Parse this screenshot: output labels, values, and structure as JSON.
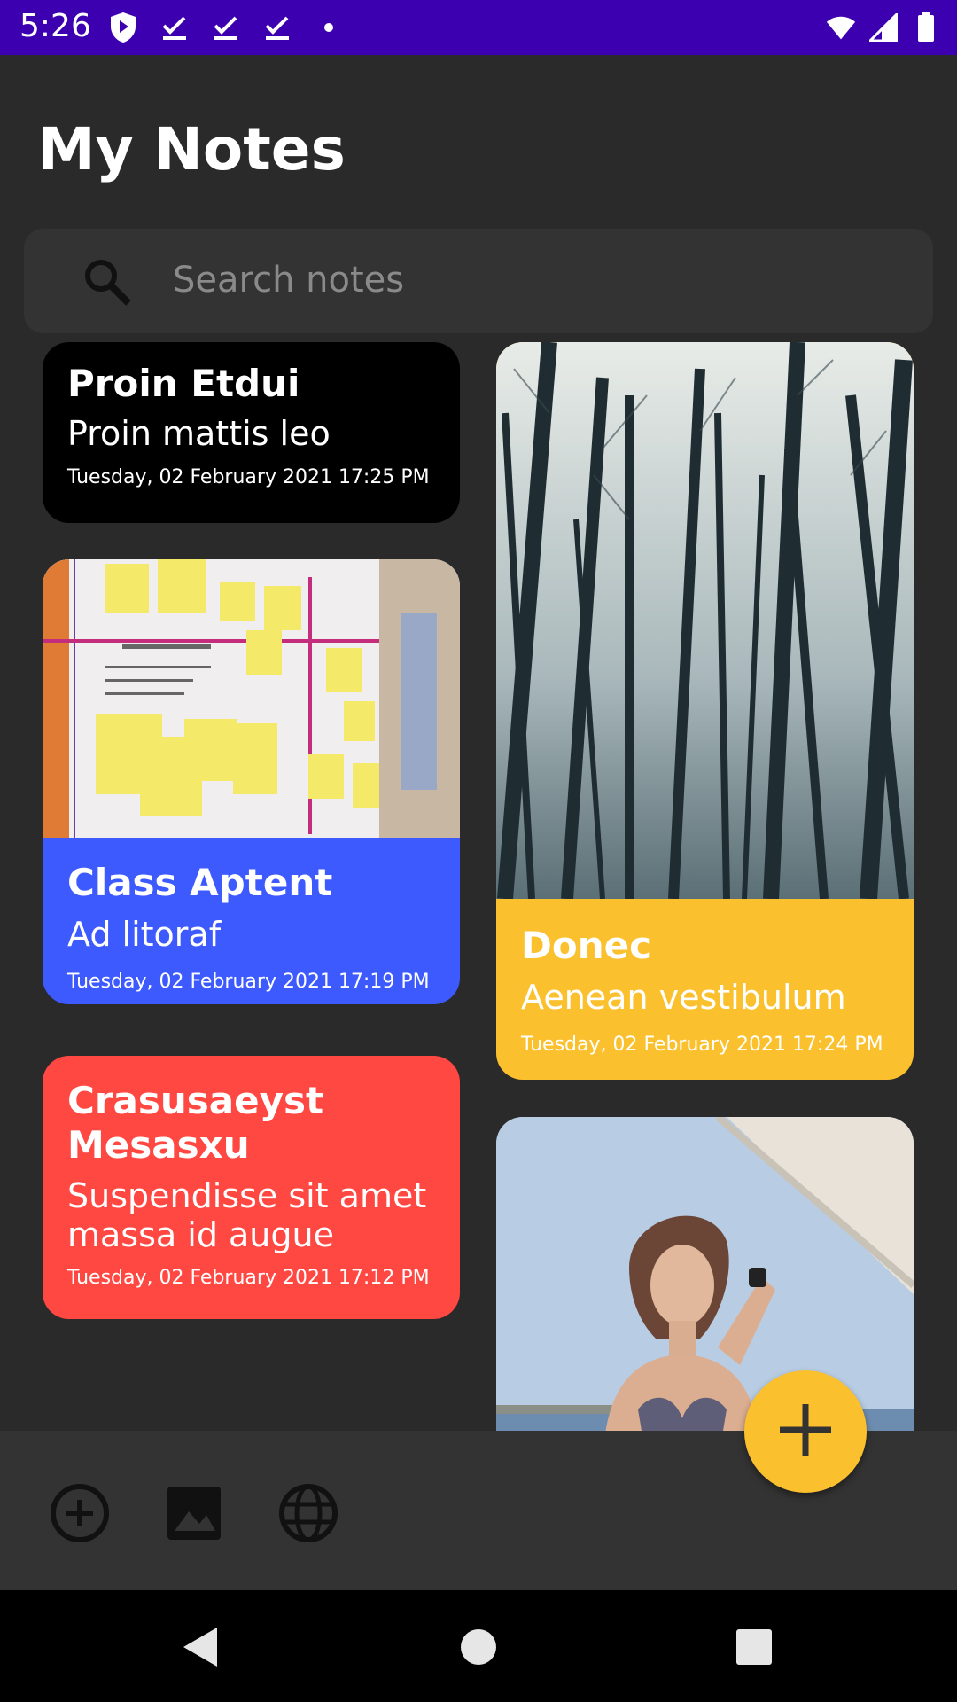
{
  "status_bar": {
    "time": "5:26",
    "left_icons": [
      "shield-icon",
      "check-icon",
      "check-icon",
      "check-icon",
      "dot-icon"
    ],
    "right_icons": [
      "wifi-icon",
      "signal-icon",
      "battery-icon"
    ],
    "color": "#3d00b0"
  },
  "header": {
    "title": "My Notes"
  },
  "search": {
    "placeholder": "Search notes"
  },
  "notes": [
    {
      "title": "Proin Etdui",
      "subtitle": "Proin mattis leo",
      "date": "Tuesday, 02 February 2021 17:25 PM",
      "color": "#000000",
      "image": ""
    },
    {
      "title": "Class Aptent",
      "subtitle": "Ad litoraf",
      "date": "Tuesday, 02 February 2021 17:19 PM",
      "color": "#3d5afe",
      "image": "sticky-notes-whiteboard-photo"
    },
    {
      "title": "Crasusaeyst Mesasxu",
      "subtitle": "Suspendisse sit amet massa id augue",
      "date": "Tuesday, 02 February 2021 17:12 PM",
      "color": "#ff4842",
      "image": ""
    },
    {
      "title": "Donec",
      "subtitle": "Aenean vestibulum",
      "date": "Tuesday, 02 February 2021 17:24 PM",
      "color": "#fbc02d",
      "image": "misty-forest-trees-photo"
    },
    {
      "title": "",
      "subtitle": "",
      "date": "",
      "color": "",
      "image": "woman-at-beach-photo"
    }
  ],
  "toolbar": {
    "icons": [
      "add-circle-icon",
      "image-icon",
      "globe-icon"
    ],
    "fab_icon": "plus-icon",
    "fab_color": "#fbc02d"
  },
  "nav": {
    "icons": [
      "back-icon",
      "home-icon",
      "recents-icon"
    ]
  }
}
